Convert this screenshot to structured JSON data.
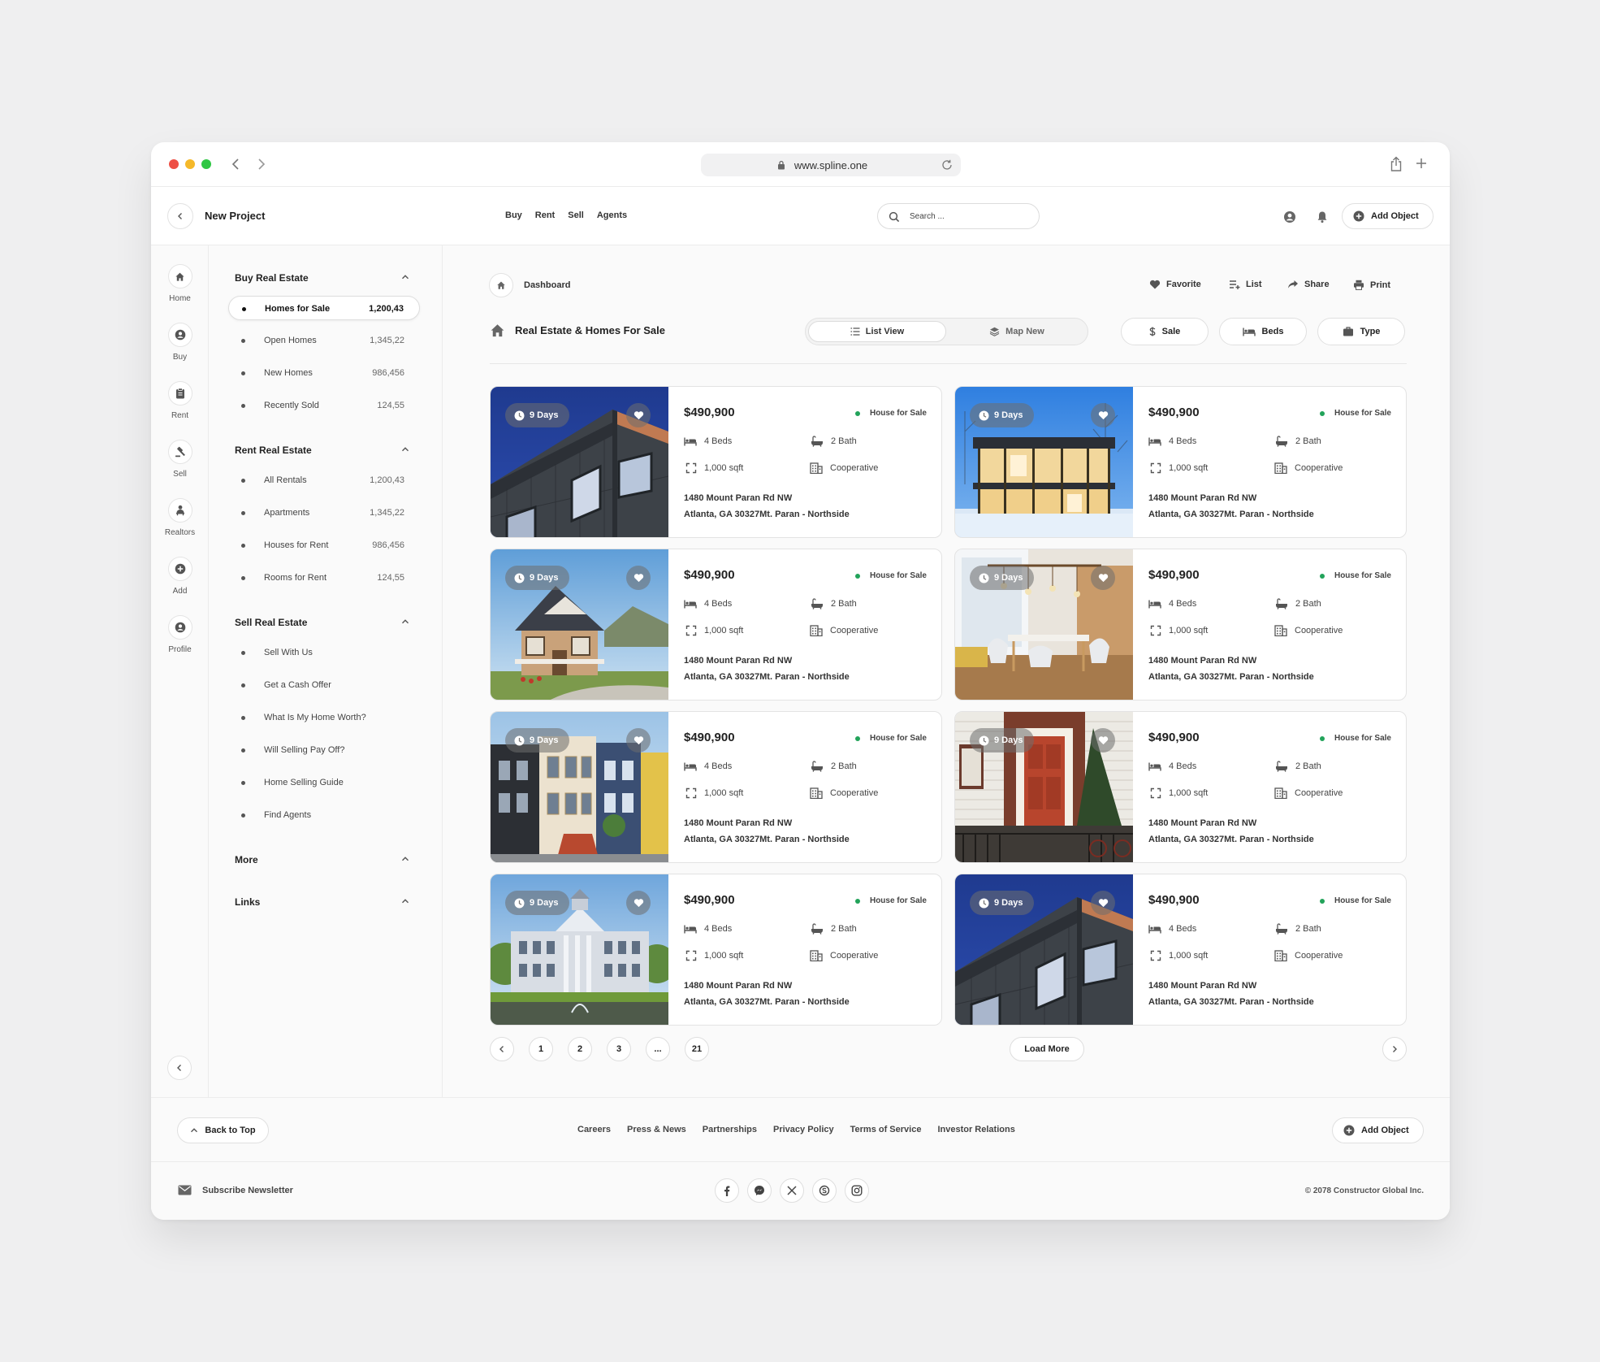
{
  "browser": {
    "url": "www.spline.one"
  },
  "header": {
    "project_title": "New Project",
    "nav": [
      "Buy",
      "Rent",
      "Sell",
      "Agents"
    ],
    "search_placeholder": "Search ...",
    "add_object_label": "Add Object"
  },
  "rail": [
    {
      "label": "Home",
      "icon": "home-icon"
    },
    {
      "label": "Buy",
      "icon": "user-circle-icon"
    },
    {
      "label": "Rent",
      "icon": "clipboard-icon"
    },
    {
      "label": "Sell",
      "icon": "gavel-icon"
    },
    {
      "label": "Realtors",
      "icon": "realtor-icon"
    },
    {
      "label": "Add",
      "icon": "plus-circle-icon"
    },
    {
      "label": "Profile",
      "icon": "profile-icon"
    }
  ],
  "sidebar": {
    "sections": [
      {
        "title": "Buy Real Estate",
        "items": [
          {
            "label": "Homes for Sale",
            "count": "1,200,43",
            "active": true
          },
          {
            "label": "Open Homes",
            "count": "1,345,22"
          },
          {
            "label": "New Homes",
            "count": "986,456"
          },
          {
            "label": "Recently Sold",
            "count": "124,55"
          }
        ]
      },
      {
        "title": "Rent Real Estate",
        "items": [
          {
            "label": "All Rentals",
            "count": "1,200,43"
          },
          {
            "label": "Apartments",
            "count": "1,345,22"
          },
          {
            "label": "Houses for Rent",
            "count": "986,456"
          },
          {
            "label": "Rooms for Rent",
            "count": "124,55"
          }
        ]
      },
      {
        "title": "Sell Real Estate",
        "items": [
          {
            "label": "Sell With Us",
            "count": ""
          },
          {
            "label": "Get a Cash Offer",
            "count": ""
          },
          {
            "label": "What Is My Home Worth?",
            "count": ""
          },
          {
            "label": "Will Selling Pay Off?",
            "count": ""
          },
          {
            "label": "Home Selling Guide",
            "count": ""
          },
          {
            "label": "Find Agents",
            "count": ""
          }
        ]
      },
      {
        "title": "More",
        "items": []
      },
      {
        "title": "Links",
        "items": []
      }
    ]
  },
  "main": {
    "breadcrumb": "Dashboard",
    "actions": [
      {
        "label": "Favorite",
        "icon": "heart-icon"
      },
      {
        "label": "List",
        "icon": "list-add-icon"
      },
      {
        "label": "Share",
        "icon": "share-icon"
      },
      {
        "label": "Print",
        "icon": "print-icon"
      }
    ],
    "page_title": "Real Estate & Homes For Sale",
    "views": [
      {
        "label": "List View",
        "active": true
      },
      {
        "label": "Map New",
        "active": false
      }
    ],
    "filters": [
      "Sale",
      "Beds",
      "Type"
    ],
    "listings": [
      {
        "days": "9 Days",
        "price": "$490,900",
        "status": "House for Sale",
        "beds": "4 Beds",
        "baths": "2 Bath",
        "area": "1,000 sqft",
        "kind": "Cooperative",
        "address1": "1480 Mount Paran Rd NW",
        "address2": "Atlanta, GA 30327Mt. Paran - Northside",
        "photo": "modern-facade"
      },
      {
        "days": "9 Days",
        "price": "$490,900",
        "status": "House for Sale",
        "beds": "4 Beds",
        "baths": "2 Bath",
        "area": "1,000 sqft",
        "kind": "Cooperative",
        "address1": "1480 Mount Paran Rd NW",
        "address2": "Atlanta, GA 30327Mt. Paran - Northside",
        "photo": "glass-house-snow"
      },
      {
        "days": "9 Days",
        "price": "$490,900",
        "status": "House for Sale",
        "beds": "4 Beds",
        "baths": "2 Bath",
        "area": "1,000 sqft",
        "kind": "Cooperative",
        "address1": "1480 Mount Paran Rd NW",
        "address2": "Atlanta, GA 30327Mt. Paran - Northside",
        "photo": "craftsman-house"
      },
      {
        "days": "9 Days",
        "price": "$490,900",
        "status": "House for Sale",
        "beds": "4 Beds",
        "baths": "2 Bath",
        "area": "1,000 sqft",
        "kind": "Cooperative",
        "address1": "1480 Mount Paran Rd NW",
        "address2": "Atlanta, GA 30327Mt. Paran - Northside",
        "photo": "dining-room"
      },
      {
        "days": "9 Days",
        "price": "$490,900",
        "status": "House for Sale",
        "beds": "4 Beds",
        "baths": "2 Bath",
        "area": "1,000 sqft",
        "kind": "Cooperative",
        "address1": "1480 Mount Paran Rd NW",
        "address2": "Atlanta, GA 30327Mt. Paran - Northside",
        "photo": "victorian-row"
      },
      {
        "days": "9 Days",
        "price": "$490,900",
        "status": "House for Sale",
        "beds": "4 Beds",
        "baths": "2 Bath",
        "area": "1,000 sqft",
        "kind": "Cooperative",
        "address1": "1480 Mount Paran Rd NW",
        "address2": "Atlanta, GA 30327Mt. Paran - Northside",
        "photo": "red-door"
      },
      {
        "days": "9 Days",
        "price": "$490,900",
        "status": "House for Sale",
        "beds": "4 Beds",
        "baths": "2 Bath",
        "area": "1,000 sqft",
        "kind": "Cooperative",
        "address1": "1480 Mount Paran Rd NW",
        "address2": "Atlanta, GA 30327Mt. Paran - Northside",
        "photo": "mansion"
      },
      {
        "days": "9 Days",
        "price": "$490,900",
        "status": "House for Sale",
        "beds": "4 Beds",
        "baths": "2 Bath",
        "area": "1,000 sqft",
        "kind": "Cooperative",
        "address1": "1480 Mount Paran Rd NW",
        "address2": "Atlanta, GA 30327Mt. Paran - Northside",
        "photo": "modern-facade"
      }
    ],
    "pagination": {
      "pages": [
        "1",
        "2",
        "3",
        "...",
        "21"
      ],
      "load_more": "Load More"
    }
  },
  "footer": {
    "back_to_top": "Back to Top",
    "links": [
      "Careers",
      "Press & News",
      "Partnerships",
      "Privacy Policy",
      "Terms of Service",
      "Investor Relations"
    ],
    "add_object": "Add Object",
    "newsletter": "Subscribe Newsletter",
    "social": [
      "facebook-icon",
      "messenger-icon",
      "x-icon",
      "skype-icon",
      "instagram-icon"
    ],
    "copyright": "© 2078 Constructor Global Inc."
  },
  "colors": {
    "status_dot": "#22a35a",
    "traffic_red": "#ee4f45",
    "traffic_yellow": "#f5b92a",
    "traffic_green": "#2fc744"
  }
}
